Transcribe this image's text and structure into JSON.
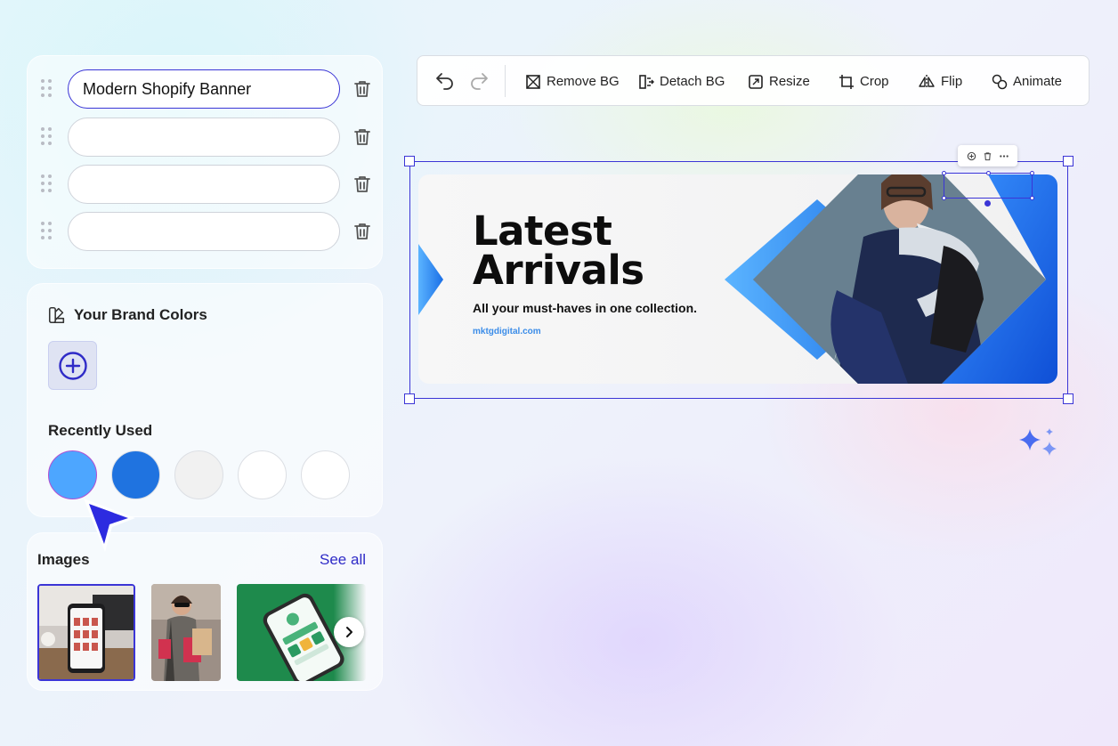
{
  "titles": {
    "items": [
      {
        "value": "Modern Shopify Banner",
        "placeholder": ""
      },
      {
        "value": "",
        "placeholder": ""
      },
      {
        "value": "",
        "placeholder": ""
      },
      {
        "value": "",
        "placeholder": ""
      }
    ]
  },
  "brand": {
    "heading": "Your Brand Colors",
    "recent_label": "Recently Used",
    "recent_colors": [
      "#4da6ff",
      "#1f73e0",
      "#f1f1f1",
      "#ffffff",
      "#ffffff"
    ]
  },
  "images": {
    "label": "Images",
    "see_all": "See all"
  },
  "toolbar": {
    "remove_bg": "Remove BG",
    "detach_bg": "Detach BG",
    "resize": "Resize",
    "crop": "Crop",
    "flip": "Flip",
    "animate": "Animate"
  },
  "banner": {
    "title_line1": "Latest",
    "title_line2": "Arrivals",
    "subtitle": "All your must-haves in one collection.",
    "url": "mktgdigital.com"
  },
  "colors": {
    "accent": "#3b35d6",
    "banner_blue": "#2f7cf0"
  }
}
